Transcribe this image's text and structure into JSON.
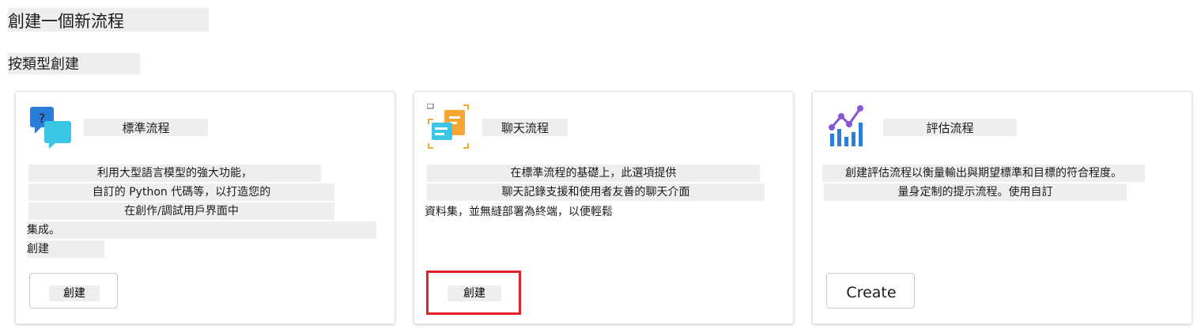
{
  "page": {
    "title": "創建一個新流程",
    "section_title": "按類型創建"
  },
  "cards": {
    "standard": {
      "icon": "chat-bubbles-question-icon",
      "title": "標準流程",
      "lines": [
        "利用大型語言模型的強大功能，",
        "自訂的 Python 代碼等，以打造您的",
        "在創作/調試用戶界面中",
        "集成。",
        "創建"
      ],
      "button_label": "創建"
    },
    "chat": {
      "icon": "chat-document-icon",
      "title": "聊天流程",
      "lines": [
        "在標準流程的基礎上，此選項提供",
        "聊天記錄支援和使用者友善的聊天介面",
        "資料集，並無縫部署為終端，以便輕鬆"
      ],
      "button_label": "創建",
      "highlight_color": "#e1212a"
    },
    "eval": {
      "icon": "bar-chart-line-icon",
      "title": "評估流程",
      "lines": [
        "創建評估流程以衡量輸出與期望標準和目標的符合程度。",
        "量身定制的提示流程。使用自訂"
      ],
      "button_label": "Create"
    }
  },
  "colors": {
    "accent_red": "#e1212a",
    "icon_blue": "#2a7dd8",
    "icon_cyan": "#38c5e6",
    "icon_orange": "#f7a535",
    "icon_purple": "#8b55d8"
  }
}
